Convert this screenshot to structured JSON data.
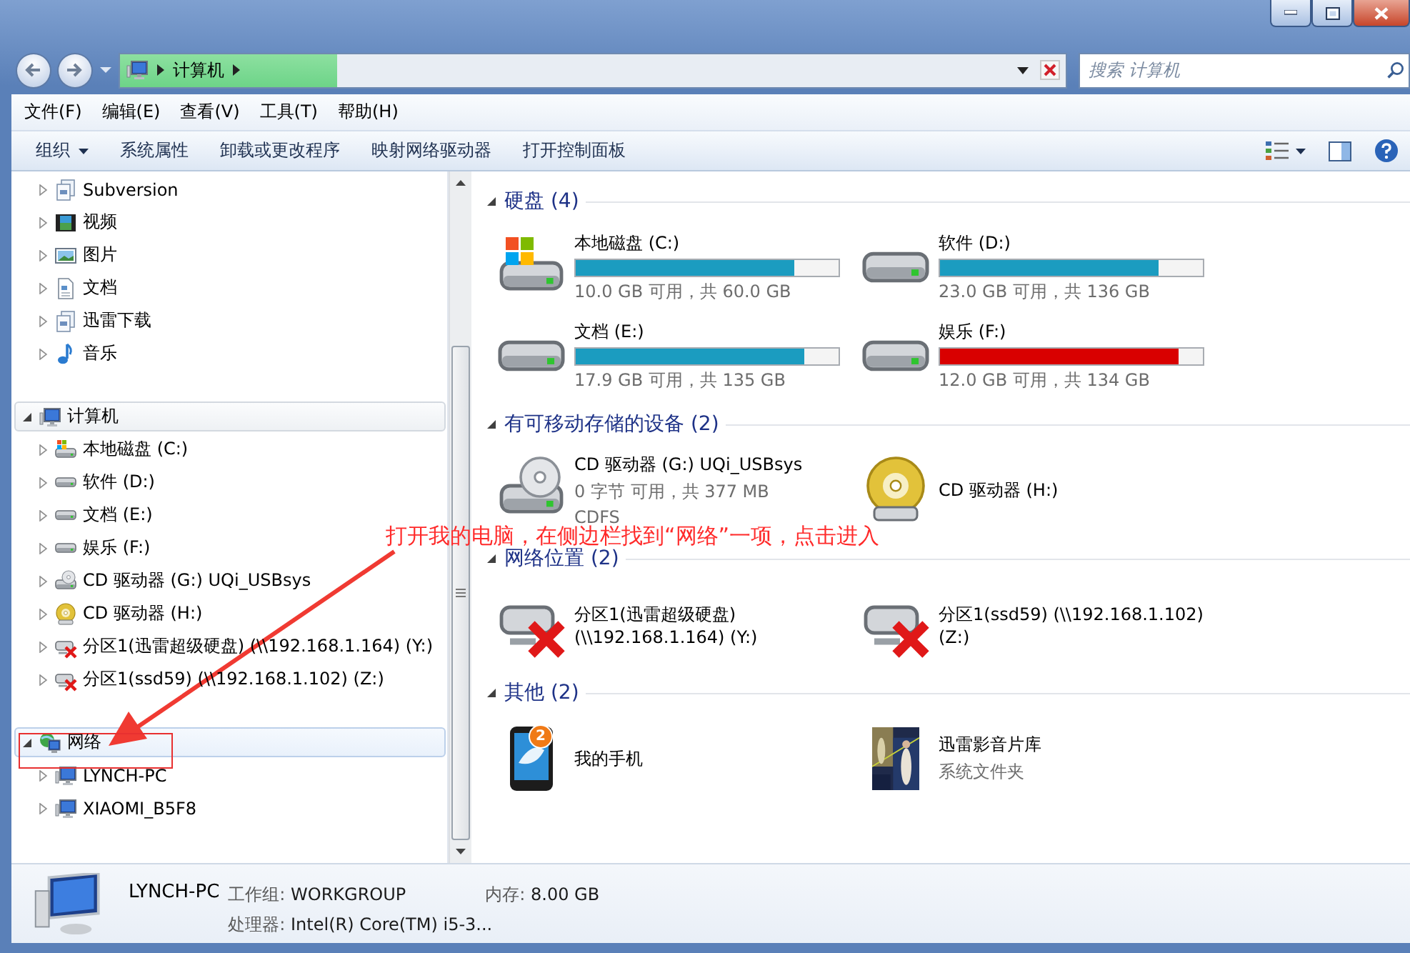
{
  "navigation": {
    "address": {
      "crumb": "计算机",
      "level": 0.23
    },
    "search": {
      "placeholder": "搜索 计算机"
    }
  },
  "menu": [
    "文件(F)",
    "编辑(E)",
    "查看(V)",
    "工具(T)",
    "帮助(H)"
  ],
  "toolbar": [
    {
      "label": "组织",
      "kind": "dropdown"
    },
    {
      "label": "系统属性",
      "kind": "plain"
    },
    {
      "label": "卸载或更改程序",
      "kind": "plain"
    },
    {
      "label": "映射网络驱动器",
      "kind": "plain"
    },
    {
      "label": "打开控制面板",
      "kind": "plain"
    }
  ],
  "sidebar": {
    "libraries": [
      {
        "label": "Subversion",
        "kind": "library",
        "expanded": false,
        "selected": false
      },
      {
        "label": "视频",
        "kind": "video",
        "expanded": false,
        "selected": false
      },
      {
        "label": "图片",
        "kind": "pictures",
        "expanded": false,
        "selected": false
      },
      {
        "label": "文档",
        "kind": "document",
        "expanded": false,
        "selected": false
      },
      {
        "label": "迅雷下载",
        "kind": "library",
        "expanded": false,
        "selected": false
      },
      {
        "label": "音乐",
        "kind": "music",
        "expanded": false,
        "selected": false
      }
    ],
    "items": [
      {
        "label": "计算机",
        "kind": "computer",
        "expanded": true,
        "selected": false,
        "children": [
          {
            "label": "本地磁盘 (C:)",
            "kind": "system-disk",
            "expanded": false,
            "selected": false
          },
          {
            "label": "软件 (D:)",
            "kind": "disk",
            "expanded": false,
            "selected": false
          },
          {
            "label": "文档 (E:)",
            "kind": "disk",
            "expanded": false,
            "selected": false
          },
          {
            "label": "娱乐 (F:)",
            "kind": "disk",
            "expanded": false,
            "selected": false
          },
          {
            "label": "CD 驱动器 (G:) UQi_USBsys",
            "kind": "cd-drive",
            "expanded": false,
            "selected": false
          },
          {
            "label": "CD 驱动器 (H:)",
            "kind": "dvd",
            "expanded": false,
            "selected": false
          },
          {
            "label": "分区1(迅雷超级硬盘) (\\\\192.168.1.164) (Y:)",
            "kind": "network-drive",
            "expanded": false,
            "selected": false
          },
          {
            "label": "分区1(ssd59) (\\\\192.168.1.102) (Z:)",
            "kind": "network-drive",
            "expanded": false,
            "selected": false
          }
        ]
      },
      {
        "label": "网络",
        "kind": "network",
        "expanded": true,
        "selected": true,
        "children": [
          {
            "label": "LYNCH-PC",
            "kind": "pc",
            "expanded": false,
            "selected": false
          },
          {
            "label": "XIAOMI_B5F8",
            "kind": "pc",
            "expanded": false,
            "selected": false
          }
        ]
      }
    ]
  },
  "content": {
    "groups": [
      {
        "title": "硬盘 (4)",
        "expanded": true,
        "items": [
          {
            "kind": "system-disk",
            "name": "本地磁盘 (C:)",
            "level": 0.83,
            "color": "#1b9cc0",
            "lines": [
              "10.0 GB 可用，共 60.0 GB"
            ]
          },
          {
            "kind": "disk",
            "name": "软件 (D:)",
            "level": 0.83,
            "color": "#1b9cc0",
            "lines": [
              "23.0 GB 可用，共 136 GB"
            ]
          },
          {
            "kind": "disk",
            "name": "文档 (E:)",
            "level": 0.87,
            "color": "#1b9cc0",
            "lines": [
              "17.9 GB 可用，共 135 GB"
            ]
          },
          {
            "kind": "disk",
            "name": "娱乐 (F:)",
            "level": 0.91,
            "color": "#d90000",
            "lines": [
              "12.0 GB 可用，共 134 GB"
            ]
          }
        ]
      },
      {
        "title": "有可移动存储的设备 (2)",
        "expanded": true,
        "items": [
          {
            "kind": "cd-drive",
            "name": "CD 驱动器 (G:) UQi_USBsys",
            "lines": [
              "0 字节 可用，共 377 MB",
              "CDFS"
            ]
          },
          {
            "kind": "dvd",
            "name": "CD 驱动器 (H:)"
          }
        ]
      },
      {
        "title": "网络位置 (2)",
        "expanded": true,
        "items": [
          {
            "kind": "network-drive",
            "name": "分区1(迅雷超级硬盘) (\\\\192.168.1.164) (Y:)"
          },
          {
            "kind": "network-drive",
            "name": "分区1(ssd59) (\\\\192.168.1.102) (Z:)"
          }
        ]
      },
      {
        "title": "其他 (2)",
        "expanded": true,
        "items": [
          {
            "kind": "phone",
            "name": "我的手机",
            "badge": "2"
          },
          {
            "kind": "picture",
            "name": "迅雷影音片库",
            "lines": [
              "系统文件夹"
            ]
          }
        ]
      }
    ]
  },
  "details": {
    "name": "LYNCH-PC",
    "fields": [
      {
        "label": "工作组:",
        "value": "WORKGROUP"
      },
      {
        "label": "内存:",
        "value": "8.00 GB"
      },
      {
        "label": "处理器:",
        "value": "Intel(R) Core(TM) i5-3..."
      }
    ]
  },
  "annotation": {
    "text": "打开我的电脑，在侧边栏找到“网络”一项，点击进入"
  }
}
